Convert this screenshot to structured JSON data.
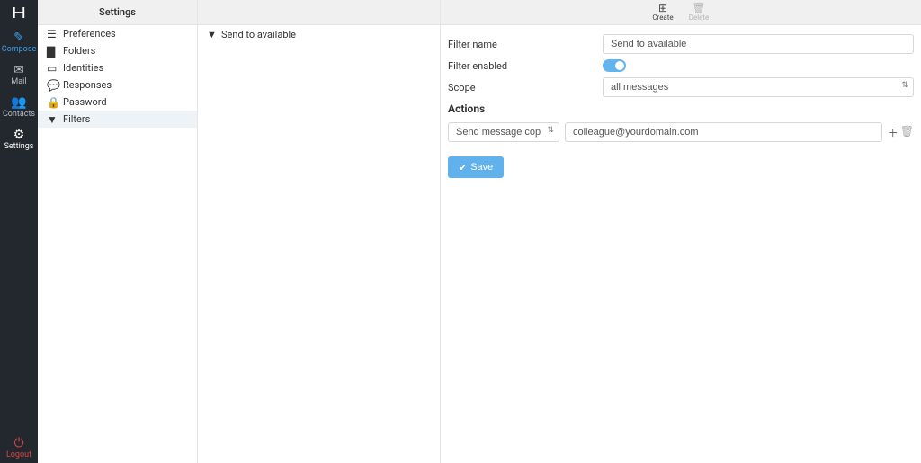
{
  "leftnav": {
    "compose": "Compose",
    "mail": "Mail",
    "contacts": "Contacts",
    "settings": "Settings",
    "logout": "Logout"
  },
  "settings_col": {
    "title": "Settings",
    "items": [
      {
        "label": "Preferences"
      },
      {
        "label": "Folders"
      },
      {
        "label": "Identities"
      },
      {
        "label": "Responses"
      },
      {
        "label": "Password"
      },
      {
        "label": "Filters"
      }
    ]
  },
  "filters_col": {
    "items": [
      {
        "label": "Send to available"
      }
    ]
  },
  "toolbar": {
    "create": "Create",
    "delete": "Delete"
  },
  "form": {
    "filter_name_label": "Filter name",
    "filter_name_value": "Send to available",
    "filter_enabled_label": "Filter enabled",
    "filter_enabled": true,
    "scope_label": "Scope",
    "scope_value": "all messages",
    "actions_title": "Actions",
    "action_type": "Send message copy to",
    "action_target": "colleague@yourdomain.com",
    "save_label": "Save"
  }
}
